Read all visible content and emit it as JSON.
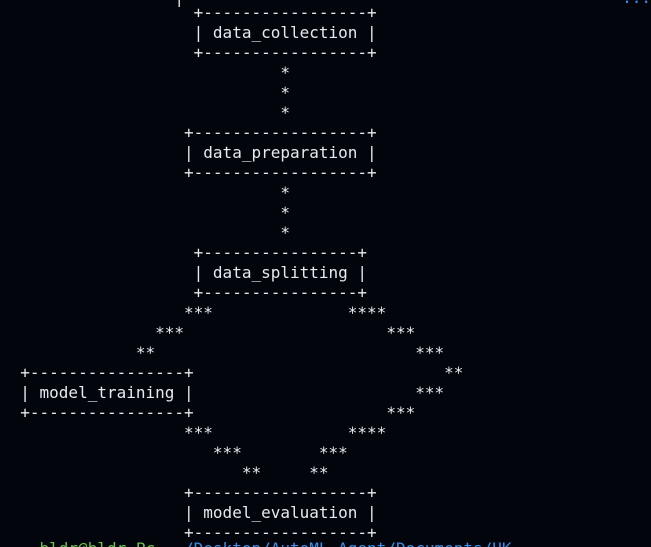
{
  "terminal": {
    "partial_top": {
      "diagram_fragment": "                  |",
      "right_fragment": "..."
    },
    "lines": [
      "                    +-----------------+",
      "                    | data_collection |",
      "                    +-----------------+",
      "                             *",
      "                             *",
      "                             *",
      "                   +------------------+",
      "                   | data_preparation |",
      "                   +------------------+",
      "                             *",
      "                             *",
      "                             *",
      "                    +----------------+",
      "                    | data_splitting |",
      "                    +----------------+",
      "                   ***              ****",
      "                ***                     ***",
      "              **                           ***",
      "  +----------------+                          **",
      "  | model_training |                       ***",
      "  +----------------+                    ***",
      "                   ***              ****",
      "                      ***        ***",
      "                         **     **",
      "                   +------------------+",
      "                   | model_evaluation |",
      "                   +------------------+"
    ],
    "partial_bottom": {
      "prompt_user": "    bldr@bldr-Pc",
      "prompt_path": "  ~/Desktop/AutoML-Agent/Documents/UK"
    }
  }
}
